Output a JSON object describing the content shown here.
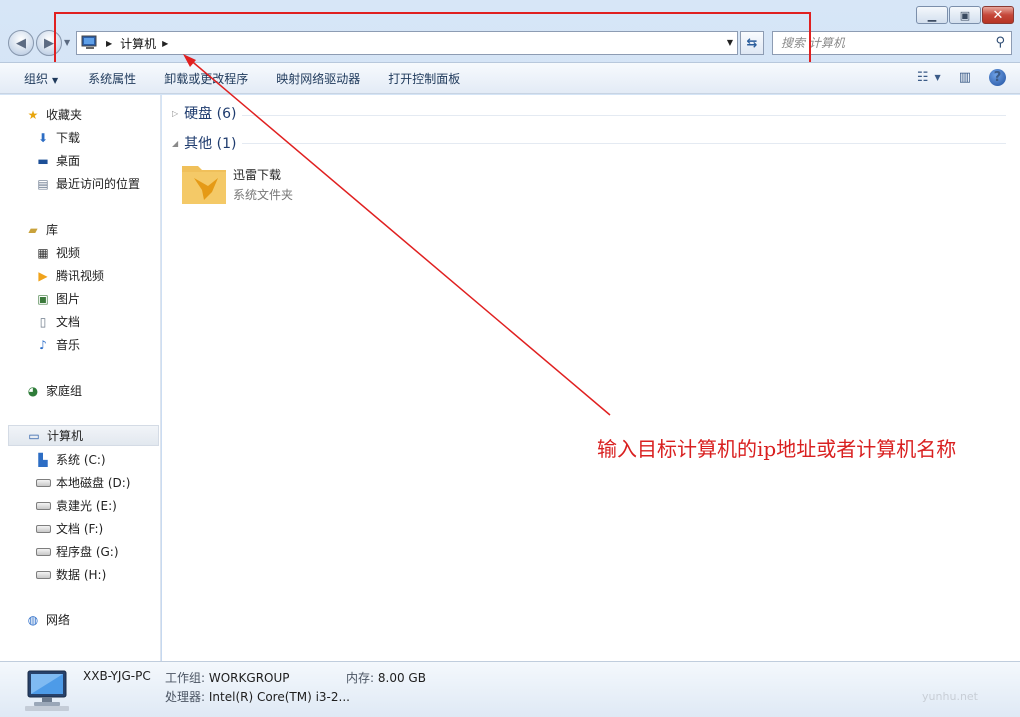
{
  "window": {
    "caption_buttons": [
      "minimize-icon",
      "maximize-icon",
      "close-icon"
    ]
  },
  "nav": {
    "back_icon": "back-arrow-icon",
    "forward_icon": "forward-arrow-icon",
    "address_crumb": "计算机",
    "search_placeholder": "搜索 计算机"
  },
  "toolbar": {
    "organize": "组织",
    "items": [
      "系统属性",
      "卸载或更改程序",
      "映射网络驱动器",
      "打开控制面板"
    ]
  },
  "sidebar": {
    "favorites": {
      "label": "收藏夹",
      "items": [
        "下载",
        "桌面",
        "最近访问的位置"
      ]
    },
    "libraries": {
      "label": "库",
      "items": [
        "视频",
        "腾讯视频",
        "图片",
        "文档",
        "音乐"
      ]
    },
    "homegroup": "家庭组",
    "computer": {
      "label": "计算机",
      "items": [
        "系统 (C:)",
        "本地磁盘 (D:)",
        "袁建光 (E:)",
        "文档 (F:)",
        "程序盘 (G:)",
        "数据 (H:)"
      ]
    },
    "network": "网络"
  },
  "content": {
    "group_hdd": "硬盘 (6)",
    "group_other": "其他 (1)",
    "item": {
      "name": "迅雷下载",
      "type": "系统文件夹"
    }
  },
  "details": {
    "pc_name": "XXB-YJG-PC",
    "workgroup_label": "工作组:",
    "workgroup": "WORKGROUP",
    "memory_label": "内存:",
    "memory": "8.00 GB",
    "cpu_label": "处理器:",
    "cpu": "Intel(R) Core(TM) i3-2...",
    "watermark": "yunhu.net"
  },
  "annotation": {
    "text": "输入目标计算机的ip地址或者计算机名称",
    "color": "#d92020"
  }
}
